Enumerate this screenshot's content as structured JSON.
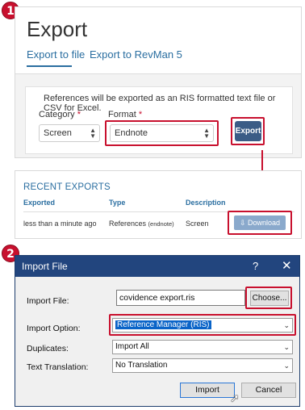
{
  "step_badges": [
    "1",
    "2"
  ],
  "export": {
    "title": "Export",
    "tabs": [
      "Export to file",
      "Export to RevMan 5"
    ],
    "info_text": "References will be exported as an RIS formatted text file or CSV for Excel.",
    "category_label": "Category",
    "format_label": "Format",
    "required_mark": "*",
    "category_value": "Screen",
    "format_value": "Endnote",
    "export_button": "Export"
  },
  "recent_exports": {
    "title": "RECENT EXPORTS",
    "columns": [
      "Exported",
      "Type",
      "Description"
    ],
    "rows": [
      {
        "exported": "less than a minute ago",
        "type": "References",
        "type_detail": "(endnote)",
        "description": "Screen"
      }
    ],
    "download_button": "Download"
  },
  "import_dialog": {
    "title": "Import File",
    "help_glyph": "?",
    "close_glyph": "✕",
    "import_file_label": "Import File:",
    "import_file_value": "covidence export.ris",
    "choose_button": "Choose...",
    "import_option_label": "Import Option:",
    "import_option_value": "Reference Manager (RIS)",
    "duplicates_label": "Duplicates:",
    "duplicates_value": "Import All",
    "text_translation_label": "Text Translation:",
    "text_translation_value": "No Translation",
    "import_button": "Import",
    "cancel_button": "Cancel"
  },
  "colors": {
    "highlight_red": "#c8102e",
    "link_blue": "#2a6ea0",
    "export_button": "#3b5c86",
    "download_button": "#8aa9cc",
    "dialog_titlebar": "#22457e",
    "selection_blue": "#0a64c8"
  },
  "icons": [
    "download-icon",
    "chevron-down-icon",
    "up-down-arrows-icon",
    "close-icon",
    "help-icon",
    "mouse-pointer-icon"
  ]
}
